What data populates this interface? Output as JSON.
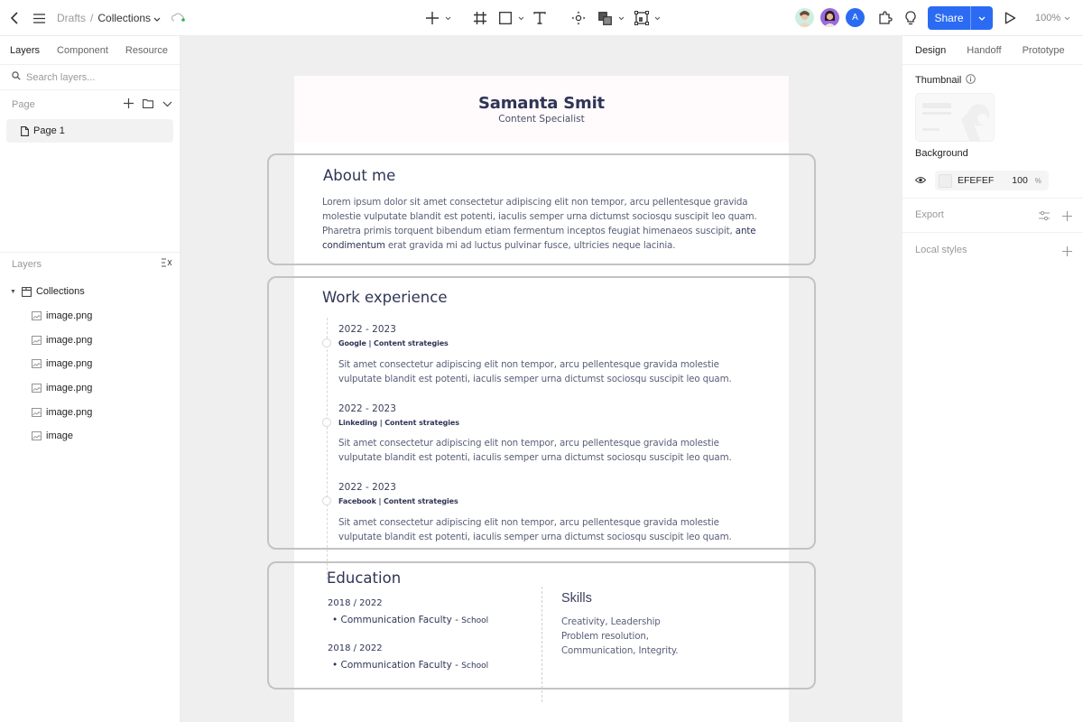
{
  "topbar": {
    "breadcrumb_parent": "Drafts",
    "breadcrumb_separator": "/",
    "breadcrumb_current": "Collections",
    "share_label": "Share",
    "zoom_level": "100%",
    "avatar_initial": "A",
    "accent_color": "#2b6bf3"
  },
  "left_panel": {
    "tabs": [
      "Layers",
      "Component",
      "Resource"
    ],
    "search_placeholder": "Search layers...",
    "page_section_label": "Page",
    "pages": [
      "Page 1"
    ],
    "layers_section_label": "Layers",
    "layers": {
      "root": "Collections",
      "children": [
        "image.png",
        "image.png",
        "image.png",
        "image.png",
        "image.png",
        "image"
      ]
    }
  },
  "resume": {
    "name": "Samanta Smit",
    "role": "Content Specialist",
    "about": {
      "title": "About me",
      "text_before_bold": "Lorem ipsum dolor sit amet consectetur adipiscing elit non tempor, arcu pellentesque gravida molestie vulputate blandit est potenti, iaculis semper urna dictumst sociosqu suscipit leo quam. Pharetra primis torquent bibendum etiam fermentum inceptos feugiat himenaeos suscipit, ",
      "text_bold": "ante condimentum",
      "text_after_bold": " erat gravida mi ad luctus pulvinar fusce, ultricies neque lacinia."
    },
    "work": {
      "title": "Work experience",
      "jobs": [
        {
          "date": "2022 - 2023",
          "title": "Google | Content strategies",
          "description_line1": "Sit amet consectetur adipiscing elit non tempor, arcu pellentesque gravida molestie",
          "description_line2": "vulputate blandit est potenti, iaculis semper urna dictumst sociosqu suscipit leo quam."
        },
        {
          "date": "2022 - 2023",
          "title": "Linkeding | Content strategies",
          "description_line1": "Sit amet consectetur adipiscing elit non tempor, arcu pellentesque gravida molestie",
          "description_line2": "vulputate blandit est potenti, iaculis semper urna dictumst sociosqu suscipit leo quam."
        },
        {
          "date": "2022 - 2023",
          "title": "Facebook | Content strategies",
          "description_line1": "Sit amet consectetur adipiscing elit non tempor, arcu pellentesque gravida molestie",
          "description_line2": "vulputate blandit est potenti, iaculis semper urna dictumst sociosqu suscipit leo quam."
        }
      ]
    },
    "education": {
      "title": "Education",
      "items": [
        {
          "date": "2018 / 2022",
          "degree": "Communication Faculty - ",
          "school": "School"
        },
        {
          "date": "2018 / 2022",
          "degree": "Communication Faculty - ",
          "school": "School"
        }
      ]
    },
    "skills": {
      "title": "Skills",
      "lines": [
        "Creativity, Leadership",
        "Problem resolution,",
        "Communication, Integrity."
      ]
    }
  },
  "right_panel": {
    "tabs": [
      "Design",
      "Handoff",
      "Prototype"
    ],
    "thumbnail_label": "Thumbnail",
    "background_label": "Background",
    "background_hex": "EFEFEF",
    "background_opacity": "100",
    "opacity_unit": "%",
    "export_label": "Export",
    "local_styles_label": "Local styles"
  }
}
